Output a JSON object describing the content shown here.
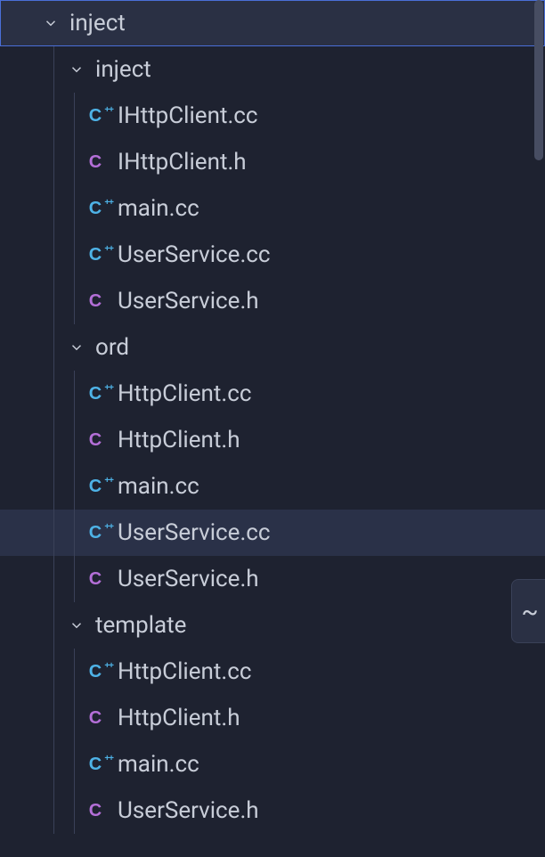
{
  "root": {
    "name": "inject",
    "expanded": true,
    "children": [
      {
        "name": "inject",
        "expanded": true,
        "children": [
          {
            "name": "IHttpClient.cc",
            "kind": "cc"
          },
          {
            "name": "IHttpClient.h",
            "kind": "h"
          },
          {
            "name": "main.cc",
            "kind": "cc"
          },
          {
            "name": "UserService.cc",
            "kind": "cc"
          },
          {
            "name": "UserService.h",
            "kind": "h"
          }
        ]
      },
      {
        "name": "ord",
        "expanded": true,
        "children": [
          {
            "name": "HttpClient.cc",
            "kind": "cc"
          },
          {
            "name": "HttpClient.h",
            "kind": "h"
          },
          {
            "name": "main.cc",
            "kind": "cc"
          },
          {
            "name": "UserService.cc",
            "kind": "cc",
            "current": true
          },
          {
            "name": "UserService.h",
            "kind": "h"
          }
        ]
      },
      {
        "name": "template",
        "expanded": true,
        "children": [
          {
            "name": "HttpClient.cc",
            "kind": "cc"
          },
          {
            "name": "HttpClient.h",
            "kind": "h"
          },
          {
            "name": "main.cc",
            "kind": "cc"
          },
          {
            "name": "UserService.h",
            "kind": "h"
          }
        ]
      }
    ]
  },
  "iconGlyphs": {
    "cc": "C",
    "h": "C"
  },
  "sideWidgetGlyph": "~"
}
